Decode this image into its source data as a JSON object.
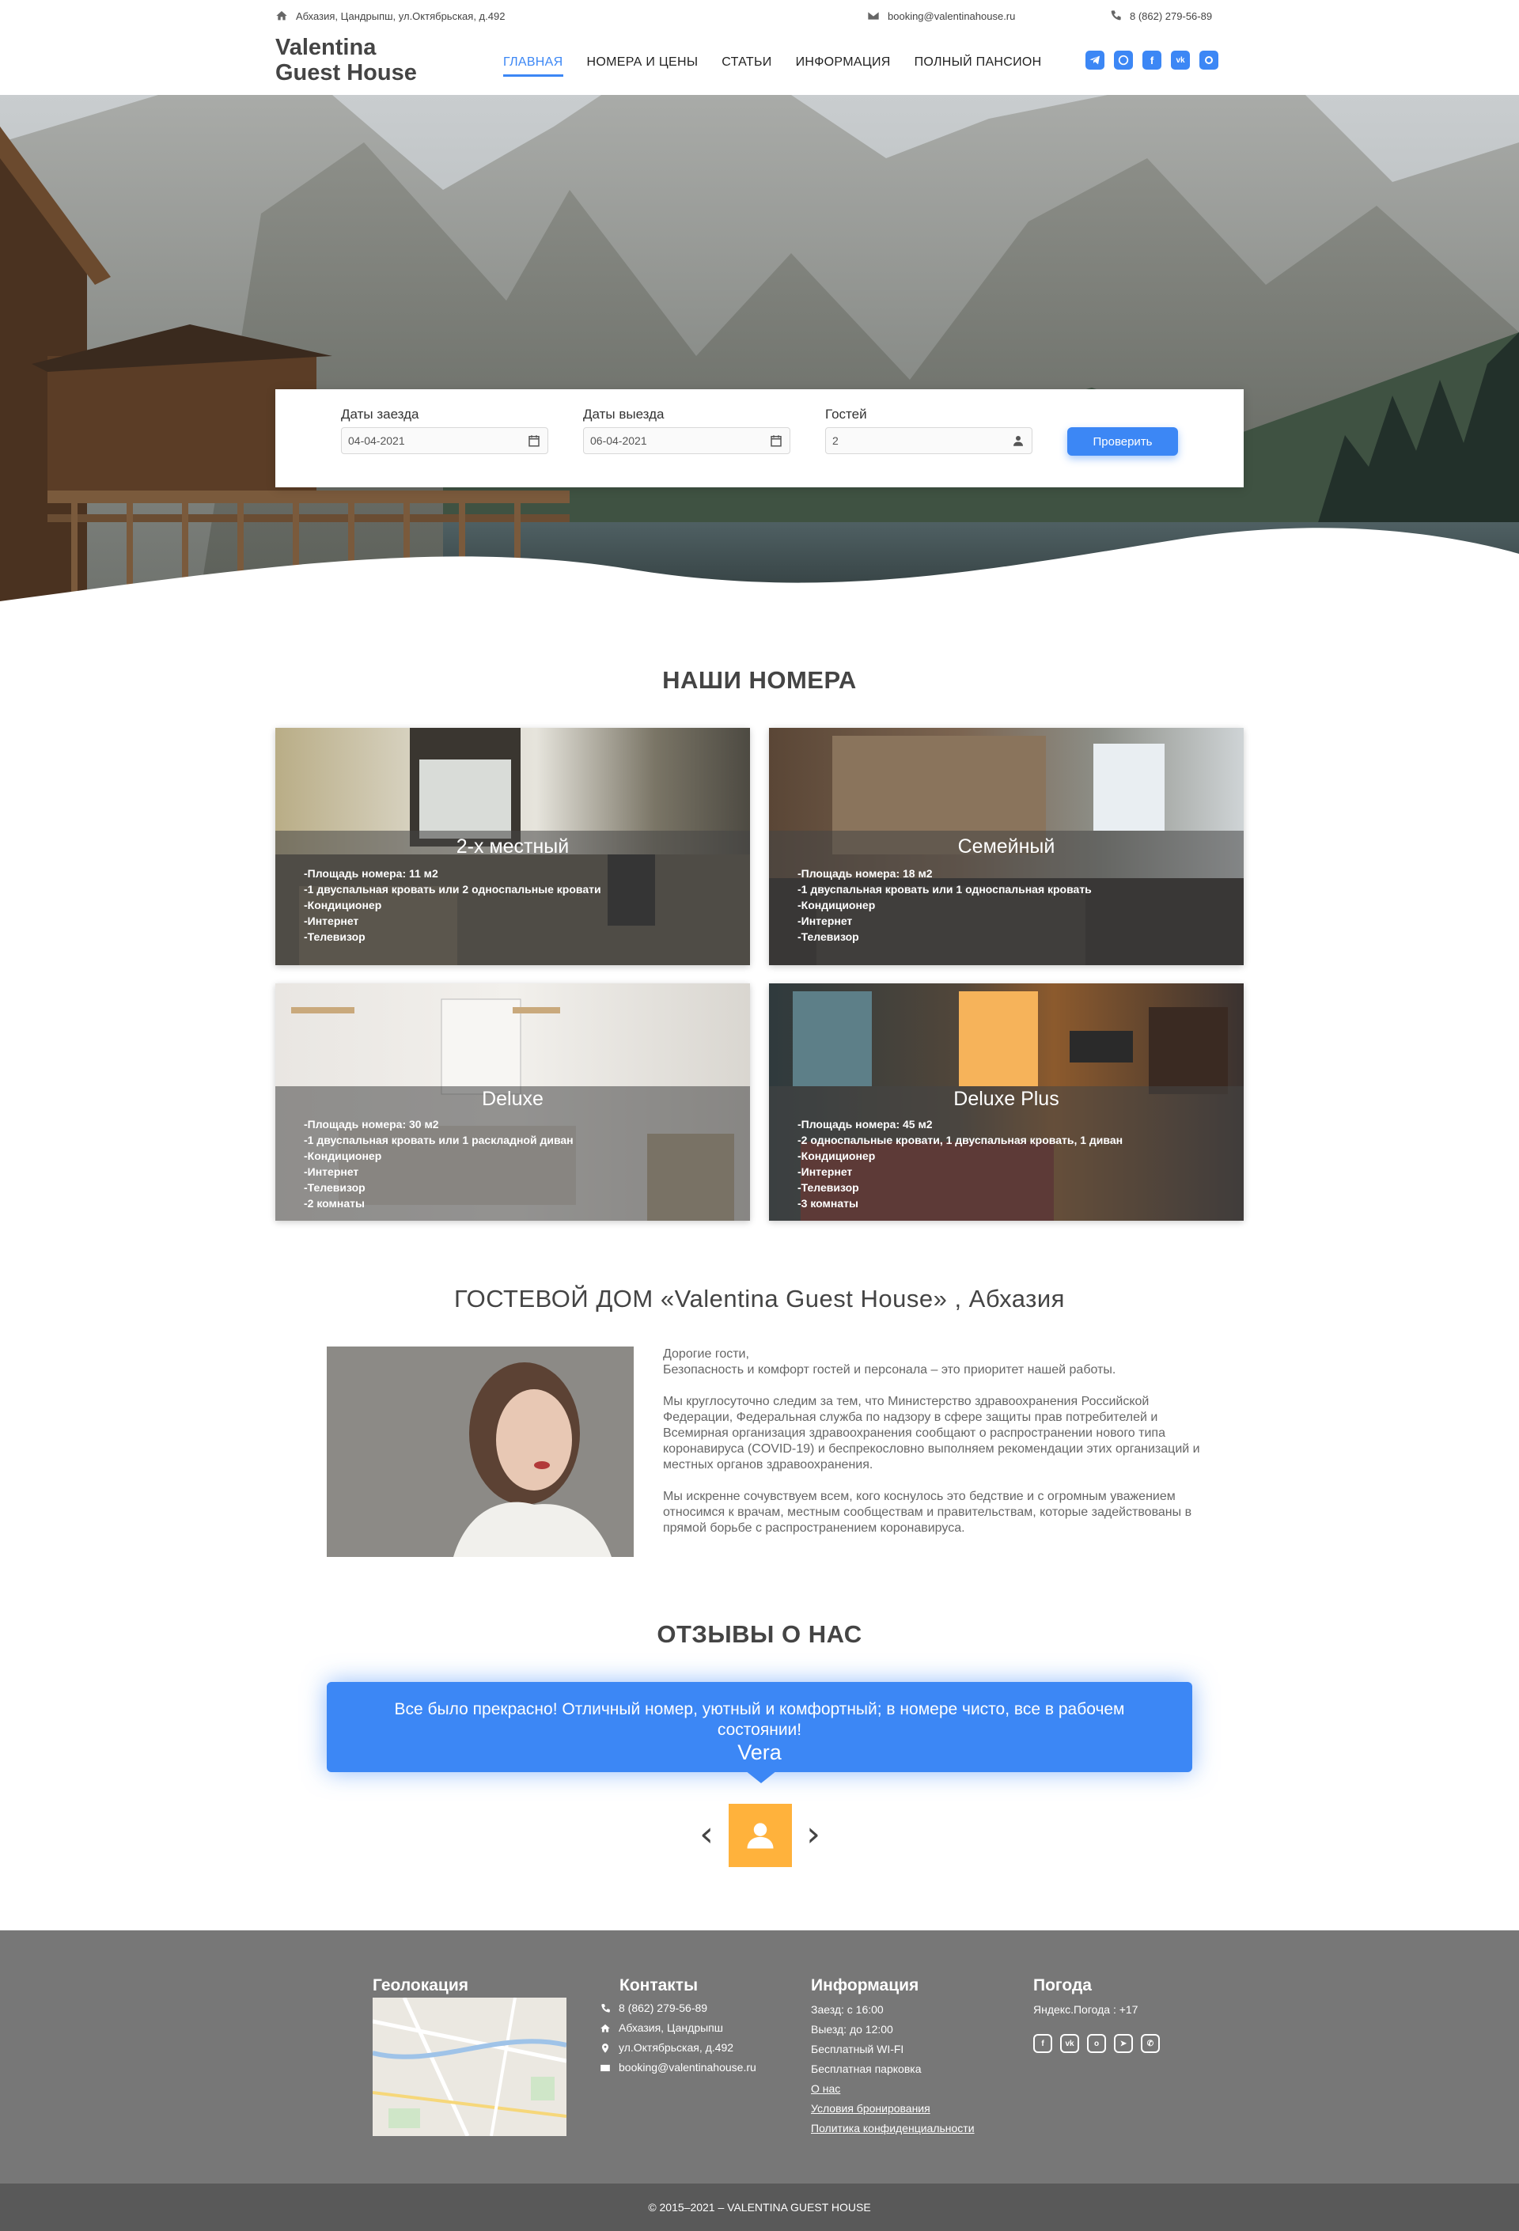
{
  "topbar": {
    "address": "Абхазия, Цандрыпш, ул.Октябрьская, д.492",
    "email": "booking@valentinahouse.ru",
    "phone": "8 (862) 279-56-89"
  },
  "logo": {
    "line1": "Valentina",
    "line2": "Guest House"
  },
  "nav": {
    "items": [
      {
        "label": "Главная",
        "active": true
      },
      {
        "label": "Номера и цены",
        "active": false
      },
      {
        "label": "Статьи",
        "active": false
      },
      {
        "label": "Информация",
        "active": false
      },
      {
        "label": "Полный пансион",
        "active": false
      }
    ]
  },
  "social_icons": [
    "telegram-icon",
    "whatsapp-icon",
    "facebook-icon",
    "vk-icon",
    "odnoklassniki-icon"
  ],
  "booking": {
    "checkin_label": "Даты заезда",
    "checkin_value": "04-04-2021",
    "checkout_label": "Даты выезда",
    "checkout_value": "06-04-2021",
    "guests_label": "Гостей",
    "guests_value": "2",
    "submit_label": "Проверить"
  },
  "rooms": {
    "title": "НАШИ НОМЕРА",
    "items": [
      {
        "name": "2-х местный",
        "features": [
          "-Площадь номера: 11 м2",
          "-1 двуспальная кровать или 2 односпальные кровати",
          "-Кондиционер",
          "-Интернет",
          "-Телевизор"
        ]
      },
      {
        "name": "Семейный",
        "features": [
          "-Площадь номера: 18 м2",
          "-1 двуспальная кровать или 1 односпальная кровать",
          "-Кондиционер",
          "-Интернет",
          "-Телевизор"
        ]
      },
      {
        "name": "Deluxe",
        "features": [
          "-Площадь номера: 30 м2",
          "-1 двуспальная кровать или 1 раскладной диван",
          "-Кондиционер",
          "-Интернет",
          "-Телевизор",
          "-2 комнаты"
        ]
      },
      {
        "name": "Deluxe Plus",
        "features": [
          "-Площадь номера: 45 м2",
          "-2 односпальные кровати, 1 двуспальная кровать, 1 диван",
          "-Кондиционер",
          "-Интернет",
          "-Телевизор",
          "-3 комнаты"
        ]
      }
    ]
  },
  "about": {
    "title": "ГОСТЕВОЙ ДОМ «Valentina Guest House» , Абхазия",
    "p1": "Дорогие гости,\nБезопасность и комфорт гостей и персонала – это приоритет нашей работы.",
    "p2": "Мы круглосуточно следим за тем, что Министерство здравоохранения Российской Федерации, Федеральная служба по надзору в сфере защиты прав потребителей и Всемирная организация здравоохранения сообщают о распространении нового типа коронавируса (COVID-19) и беспрекословно выполняем рекомендации этих организаций и местных органов здравоохранения.",
    "p3": "Мы искренне сочувствуем всем, кого коснулось это бедствие и с огромным уважением относимся к врачам, местным сообществам и правительствам, которые задействованы в прямой борьбе с распространением коронавируса."
  },
  "reviews": {
    "title": "ОТЗЫВЫ О НАС",
    "text": "Все было прекрасно! Отличный номер, уютный и комфортный; в номере чисто, все в рабочем состоянии!",
    "author": "Vera"
  },
  "footer": {
    "geo_title": "Геолокация",
    "contacts_title": "Контакты",
    "contacts": [
      {
        "icon": "phone-icon",
        "text": "8 (862) 279-56-89"
      },
      {
        "icon": "home-icon",
        "text": "Абхазия, Цандрыпш"
      },
      {
        "icon": "pin-icon",
        "text": "ул.Октябрьская, д.492"
      },
      {
        "icon": "mail-icon",
        "text": "booking@valentinahouse.ru"
      }
    ],
    "info_title": "Информация",
    "info": [
      "Заезд: с 16:00",
      "Выезд: до 12:00",
      "Бесплатный WI-FI",
      "Бесплатная парковка"
    ],
    "info_links": [
      "О нас",
      "Условия бронирования",
      "Политика конфиденциальности"
    ],
    "weather_title": "Погода",
    "weather_text": "Яндекс.Погода : +17",
    "copyright": "© 2015–2021 – VALENTINA GUEST HOUSE"
  },
  "colors": {
    "accent": "#3c87f5",
    "avatar": "#ffb23c",
    "footer": "#777777",
    "copyright_bar": "#595959"
  }
}
